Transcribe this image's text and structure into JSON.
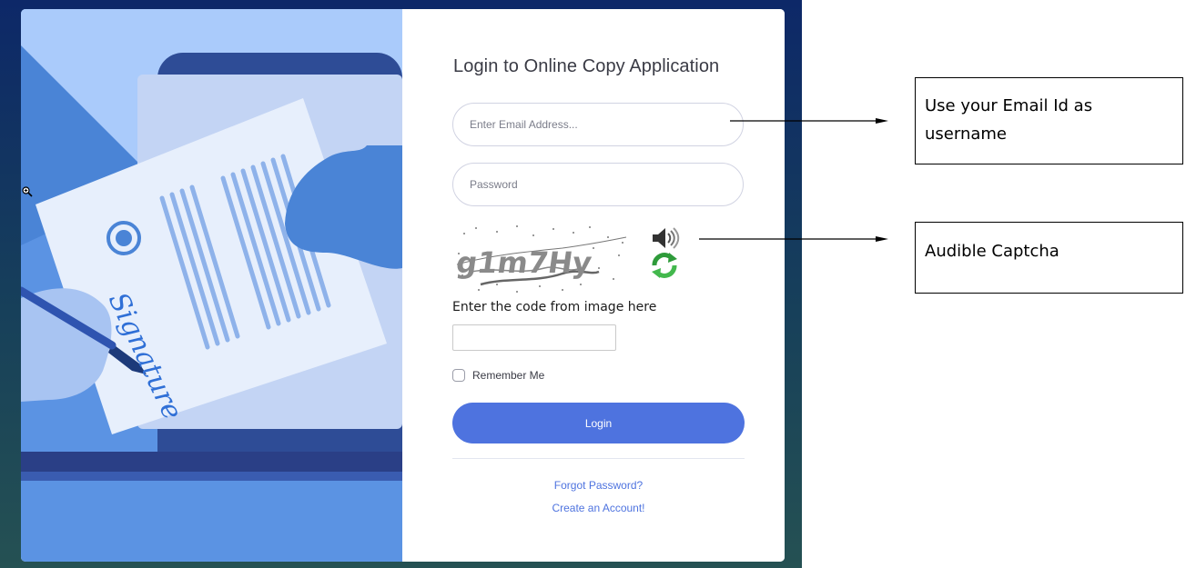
{
  "login": {
    "title": "Login to Online Copy Application",
    "email_placeholder": "Enter Email Address...",
    "password_placeholder": "Password",
    "captcha_text": "g1m7Hy",
    "captcha_label": "Enter the code from image here",
    "captcha_value": "",
    "remember_label": "Remember Me",
    "remember_checked": false,
    "login_button": "Login",
    "forgot_link": "Forgot Password?",
    "create_link": "Create an Account!"
  },
  "illustration": {
    "signature_text": "Signature"
  },
  "annotations": [
    {
      "text": "Use your Email Id as username"
    },
    {
      "text": "Audible Captcha"
    }
  ],
  "icons": {
    "audio": "speaker-icon",
    "refresh": "refresh-icon",
    "magnifier": "zoom-in-cursor-icon"
  },
  "colors": {
    "primary": "#4e73df",
    "illustration_bg": "#5b93e3",
    "page_bg_top": "#0d2868",
    "page_bg_bottom": "#255153"
  }
}
